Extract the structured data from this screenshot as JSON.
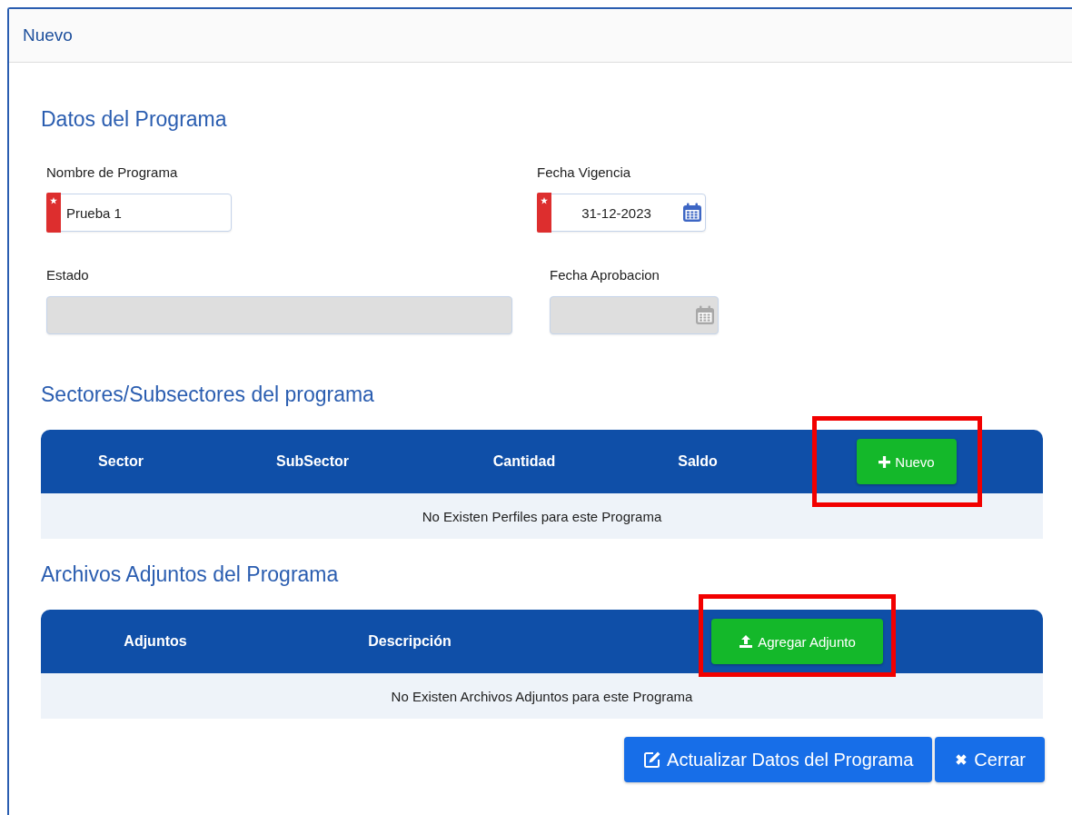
{
  "dialog_title": "Nuevo",
  "program_section": {
    "heading": "Datos del Programa",
    "fields": [
      {
        "label": "Nombre de Programa",
        "value": "Prueba 1",
        "required": true,
        "disabled": false,
        "kind": "text"
      },
      {
        "label": "Fecha Vigencia",
        "value": "31-12-2023",
        "required": true,
        "disabled": false,
        "kind": "date"
      },
      {
        "label": "Estado",
        "required": false,
        "disabled": true,
        "kind": "text"
      },
      {
        "label": "Fecha Aprobacion",
        "required": false,
        "disabled": true,
        "kind": "date"
      }
    ]
  },
  "tables": [
    {
      "heading": "Sectores/Subsectores del programa",
      "columns": [
        "Sector",
        "SubSector",
        "Cantidad",
        "Saldo"
      ],
      "action": {
        "label": "Nuevo",
        "kind": "plus",
        "highlighted": true
      },
      "empty_message": "No Existen Perfiles para este Programa"
    },
    {
      "heading": "Archivos Adjuntos del Programa",
      "columns": [
        "Adjuntos",
        "Descripción"
      ],
      "action": {
        "label": "Agregar Adjunto",
        "kind": "upload",
        "highlighted": true
      },
      "empty_message": "No Existen Archivos Adjuntos para este Programa"
    }
  ],
  "buttons": [
    {
      "label": "Actualizar Datos del Programa",
      "kind": "edit"
    },
    {
      "label": "Cerrar",
      "kind": "close"
    }
  ]
}
